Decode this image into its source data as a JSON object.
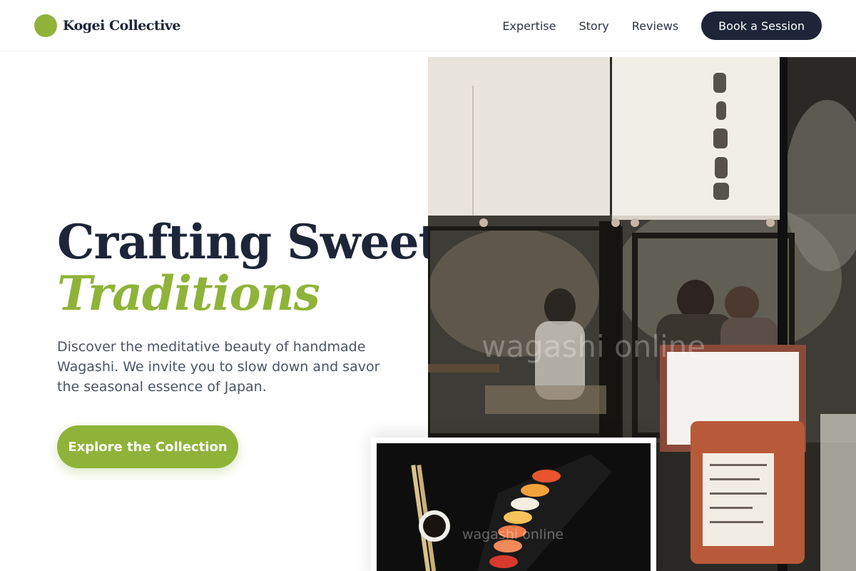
{
  "brand": {
    "name": "Kogei Collective"
  },
  "nav": {
    "links": [
      "Expertise",
      "Story",
      "Reviews"
    ],
    "cta_label": "Book a Session"
  },
  "hero": {
    "title_line1": "Crafting Sweet",
    "title_line2": "Traditions",
    "description": "Discover the meditative beauty of handmade Wagashi. We invite you to slow down and savor the seasonal essence of Japan.",
    "cta_label": "Explore the Collection"
  },
  "images": {
    "main_watermark": "wagashi online",
    "sushi_watermark": "wagashi online"
  },
  "colors": {
    "accent": "#8fb339",
    "navy": "#1e2538",
    "body_text": "#4a5466"
  }
}
